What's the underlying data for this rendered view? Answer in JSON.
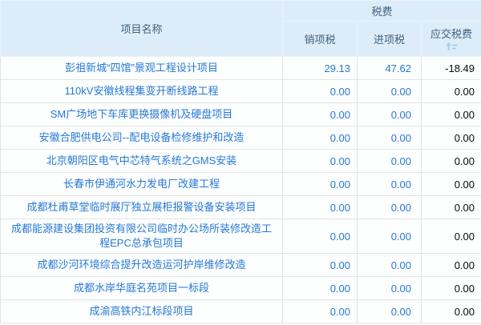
{
  "table": {
    "header": {
      "project_name": "项目名称",
      "tax_group": "税费",
      "output_tax": "销项税",
      "input_tax": "进项税",
      "tax_payable": "应交税费"
    },
    "colors": {
      "header_bg": "#ddecf9",
      "header_text": "#42617e",
      "link_blue": "#2679d5",
      "value_black": "#0a0a0a",
      "grid_line": "#e4e4e4",
      "sort_icon_blue": "#a3c9e9"
    },
    "rows": [
      {
        "name": "彭祖新城“四馆”景观工程设计项目",
        "output_tax": "29.13",
        "input_tax": "47.62",
        "tax_payable": "-18.49"
      },
      {
        "name": "110kV安徽线程集变开断线路工程",
        "output_tax": "0.00",
        "input_tax": "0.00",
        "tax_payable": "0.00"
      },
      {
        "name": "SM广场地下车库更换摄像机及硬盘项目",
        "output_tax": "0.00",
        "input_tax": "0.00",
        "tax_payable": "0.00"
      },
      {
        "name": "安徽合肥供电公司--配电设备检修维护和改造",
        "output_tax": "0.00",
        "input_tax": "0.00",
        "tax_payable": "0.00"
      },
      {
        "name": "北京朝阳区电气中芯特气系统之GMS安装",
        "output_tax": "0.00",
        "input_tax": "0.00",
        "tax_payable": "0.00"
      },
      {
        "name": "长春市伊通河水力发电厂改建工程",
        "output_tax": "0.00",
        "input_tax": "0.00",
        "tax_payable": "0.00"
      },
      {
        "name": "成都杜甫草堂临时展厅独立展柜报警设备安装项目",
        "output_tax": "0.00",
        "input_tax": "0.00",
        "tax_payable": "0.00"
      },
      {
        "name": "成都能源建设集团投资有限公司临时办公场所装修改造工程EPC总承包项目",
        "output_tax": "0.00",
        "input_tax": "0.00",
        "tax_payable": "0.00"
      },
      {
        "name": "成都沙河环境综合提升改造运河护岸维修改造",
        "output_tax": "0.00",
        "input_tax": "0.00",
        "tax_payable": "0.00"
      },
      {
        "name": "成都水岸华庭名苑项目一标段",
        "output_tax": "0.00",
        "input_tax": "0.00",
        "tax_payable": "0.00"
      },
      {
        "name": "成渝高铁内江标段项目",
        "output_tax": "0.00",
        "input_tax": "0.00",
        "tax_payable": "0.00"
      }
    ]
  }
}
